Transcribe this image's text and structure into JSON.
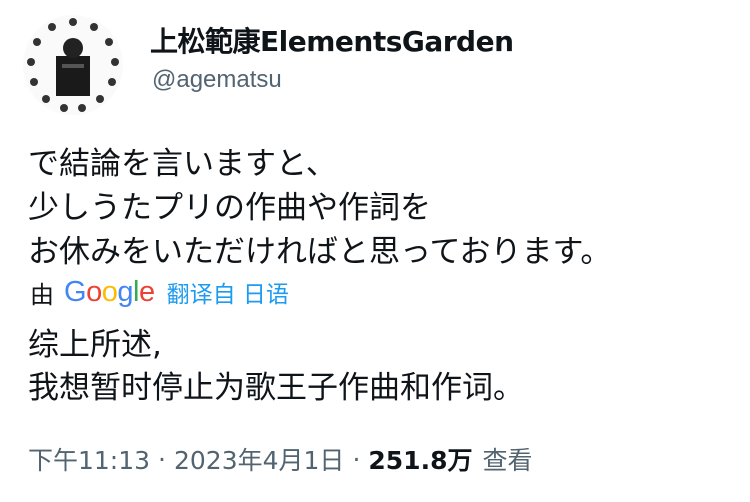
{
  "author": {
    "display_name": "上松範康ElementsGarden",
    "handle": "@agematsu"
  },
  "tweet": {
    "original_lines": [
      "で結論を言いますと、",
      "少しうたプリの作曲や作詞を",
      "お休みをいただければと思っております。"
    ],
    "translation_prefix": "由",
    "translation_provider": "Google",
    "translate_link": "翻译自 日语",
    "translated_lines": [
      "综上所述,",
      "我想暂时停止为歌王子作曲和作词。"
    ]
  },
  "meta": {
    "time": "下午11:13",
    "date": "2023年4月1日",
    "views_count": "251.8万",
    "views_label": "查看",
    "separator": "·"
  },
  "colors": {
    "text": "#0f1419",
    "secondary": "#536471",
    "link": "#1d9bf0",
    "google_blue": "#4285F4",
    "google_red": "#EA4335",
    "google_yellow": "#FBBC05",
    "google_green": "#34A853"
  }
}
